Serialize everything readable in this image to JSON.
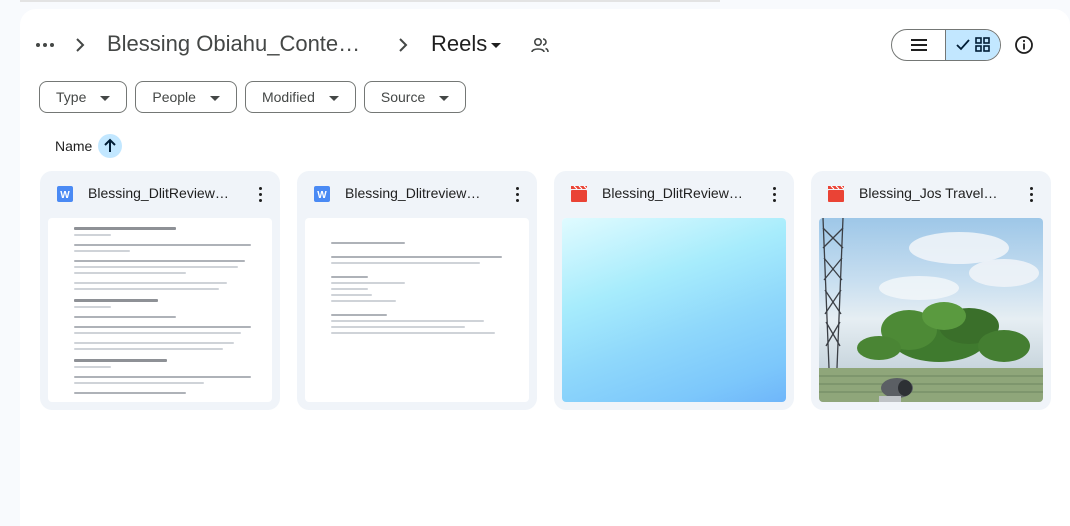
{
  "breadcrumb": {
    "folder": "Blessing Obiahu_Conte…",
    "current": "Reels"
  },
  "filters": [
    {
      "label": "Type"
    },
    {
      "label": "People"
    },
    {
      "label": "Modified"
    },
    {
      "label": "Source"
    }
  ],
  "sort": {
    "label": "Name",
    "direction": "ascending"
  },
  "files": [
    {
      "name": "Blessing_DlitReview…",
      "type": "doc",
      "icon": "word-doc-icon"
    },
    {
      "name": "Blessing_Dlitreview…",
      "type": "doc",
      "icon": "word-doc-icon"
    },
    {
      "name": "Blessing_DlitReview…",
      "type": "video",
      "icon": "video-clapper-icon"
    },
    {
      "name": "Blessing_Jos Travel…",
      "type": "video",
      "icon": "video-clapper-icon"
    }
  ],
  "colors": {
    "accent": "#c2e7ff",
    "doc_icon": "#4a8af4",
    "video_icon": "#ea4335"
  }
}
